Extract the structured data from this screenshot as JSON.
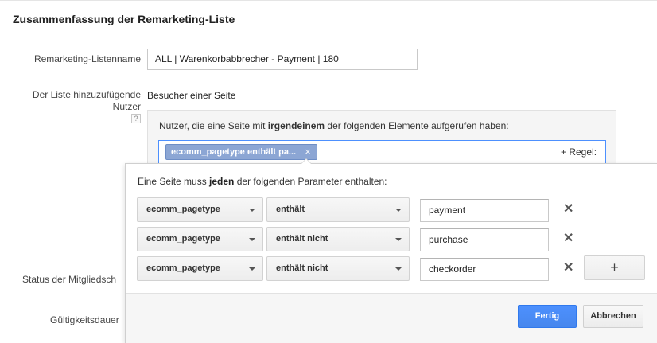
{
  "page_title": "Zusammenfassung der Remarketing-Liste",
  "form": {
    "list_name_label": "Remarketing-Listenname",
    "list_name_value": "ALL | Warenkorbabbrecher - Payment | 180",
    "users_label_line1": "Der Liste hinzuzufügende",
    "users_label_line2": "Nutzer",
    "help_icon_text": "?",
    "users_value": "Besucher einer Seite",
    "status_label": "Status der Mitgliedsch",
    "duration_label": "Gültigkeitsdauer"
  },
  "rule": {
    "intro_before": "Nutzer, die eine Seite mit ",
    "intro_bold": "irgendeinem",
    "intro_after": " der folgenden Elemente aufgerufen haben:",
    "chip_text": "ecomm_pagetype enthält pa...",
    "chip_remove": "×",
    "add_rule": "+ Regel:"
  },
  "popup": {
    "intro_before": "Eine Seite muss ",
    "intro_bold": "jeden",
    "intro_after": " der folgenden Parameter enthalten:",
    "rows": [
      {
        "param": "ecomm_pagetype",
        "operator": "enthält",
        "value": "payment"
      },
      {
        "param": "ecomm_pagetype",
        "operator": "enthält nicht",
        "value": "purchase"
      },
      {
        "param": "ecomm_pagetype",
        "operator": "enthält nicht",
        "value": "checkorder"
      }
    ],
    "remove_glyph": "✕",
    "add_glyph": "+",
    "done_label": "Fertig",
    "cancel_label": "Abbrechen"
  },
  "colors": {
    "primary_button": "#4d90fe",
    "chip_background": "#8ca6d4",
    "focus_border": "#4d90fe"
  }
}
